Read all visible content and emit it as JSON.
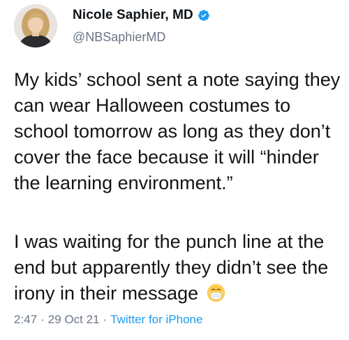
{
  "author": {
    "name": "Nicole Saphier, MD",
    "handle": "@NBSaphierMD",
    "verified": true
  },
  "tweet": {
    "paragraph1": "My kids’ school sent a note saying they can wear Halloween costumes to school tomorrow as long as they don’t cover the face because it will “hinder the learning environment.”",
    "paragraph2": "I was waiting for the punch line at the end but apparently they didn’t see the irony in their message",
    "emoji": "face-with-medical-mask"
  },
  "meta": {
    "time": "2:47",
    "separator": "·",
    "date": "29 Oct 21",
    "source": "Twitter for iPhone"
  },
  "colors": {
    "verified_badge": "#1d9bf0",
    "link": "#1d9bf0",
    "secondary_text": "#6b7785"
  }
}
